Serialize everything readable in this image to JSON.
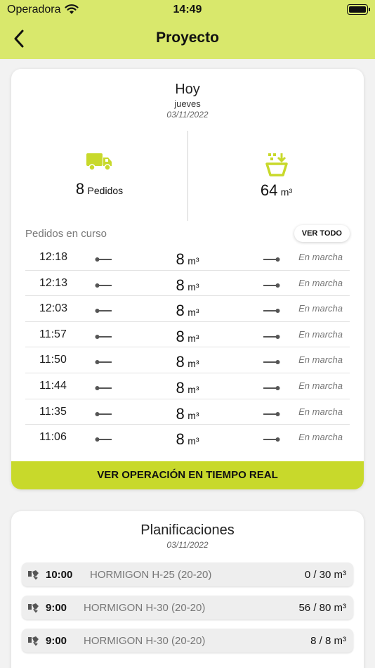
{
  "status_bar": {
    "carrier": "Operadora",
    "time": "14:49"
  },
  "nav": {
    "title": "Proyecto"
  },
  "today": {
    "label": "Hoy",
    "weekday": "jueves",
    "date": "03/11/2022",
    "orders_count": "8",
    "orders_label": "Pedidos",
    "volume": "64",
    "volume_unit": "m³"
  },
  "in_progress": {
    "label": "Pedidos en curso",
    "view_all": "VER TODO",
    "orders": [
      {
        "time": "12:18",
        "volume": "8",
        "unit": "m³",
        "status": "En marcha"
      },
      {
        "time": "12:13",
        "volume": "8",
        "unit": "m³",
        "status": "En marcha"
      },
      {
        "time": "12:03",
        "volume": "8",
        "unit": "m³",
        "status": "En marcha"
      },
      {
        "time": "11:57",
        "volume": "8",
        "unit": "m³",
        "status": "En marcha"
      },
      {
        "time": "11:50",
        "volume": "8",
        "unit": "m³",
        "status": "En marcha"
      },
      {
        "time": "11:44",
        "volume": "8",
        "unit": "m³",
        "status": "En marcha"
      },
      {
        "time": "11:35",
        "volume": "8",
        "unit": "m³",
        "status": "En marcha"
      },
      {
        "time": "11:06",
        "volume": "8",
        "unit": "m³",
        "status": "En marcha"
      }
    ],
    "realtime_button": "VER OPERACIÓN EN TIEMPO REAL"
  },
  "planning": {
    "title": "Planificaciones",
    "date": "03/11/2022",
    "items": [
      {
        "time": "10:00",
        "product": "HORMIGON H-25 (20-20)",
        "qty": "0 / 30 m³"
      },
      {
        "time": "9:00",
        "product": "HORMIGON H-30 (20-20)",
        "qty": "56 / 80 m³"
      },
      {
        "time": "9:00",
        "product": "HORMIGON H-30 (20-20)",
        "qty": "8 / 8 m³"
      }
    ]
  },
  "colors": {
    "header": "#d9e86c",
    "accent": "#c8d92b",
    "card": "#ffffff"
  },
  "icons": [
    "back-chevron-icon",
    "truck-icon",
    "hopper-icon",
    "route-start-icon",
    "route-end-icon",
    "handshake-icon",
    "wifi-icon",
    "battery-icon"
  ]
}
